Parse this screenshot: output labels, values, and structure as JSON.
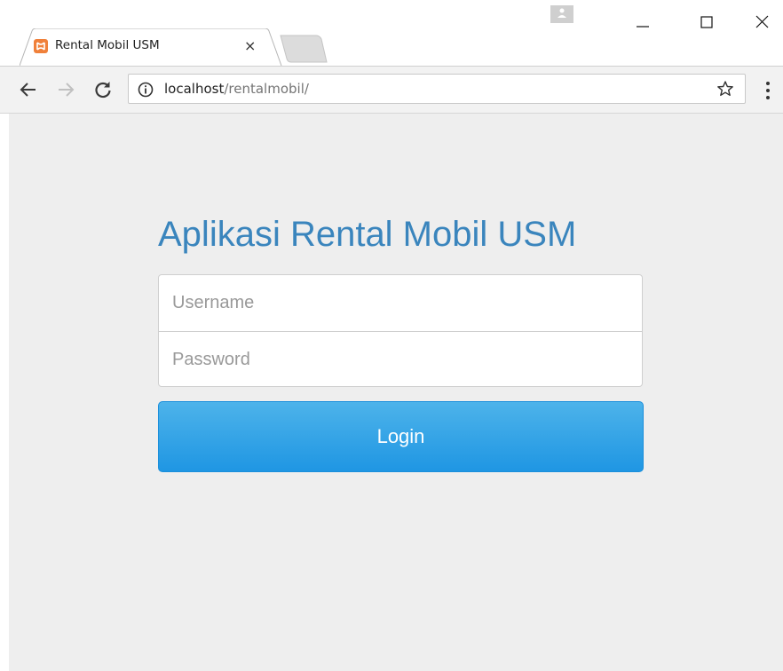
{
  "browser": {
    "tab_title": "Rental Mobil USM",
    "tab_close": "×",
    "url_host": "localhost",
    "url_path": "/rentalmobil/"
  },
  "page": {
    "heading": "Aplikasi Rental Mobil USM",
    "username_placeholder": "Username",
    "password_placeholder": "Password",
    "login_label": "Login"
  },
  "colors": {
    "heading": "#3a85bd",
    "button_top": "#4db3ea",
    "button_bottom": "#1f96e3",
    "page_background": "#eeeeee"
  },
  "icons": {
    "favicon": "xampp-icon",
    "profile": "profile-icon",
    "back": "arrow-left-icon",
    "forward": "arrow-right-icon",
    "reload": "reload-icon",
    "info": "info-icon",
    "bookmark": "star-icon",
    "menu": "more-vertical-icon"
  }
}
